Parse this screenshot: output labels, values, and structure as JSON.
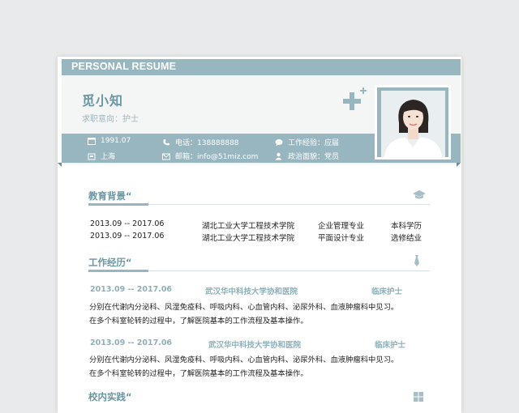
{
  "banner_title": "PERSONAL RESUME",
  "profile": {
    "name": "觅小知",
    "job_intention": "求职意向：护士"
  },
  "info": {
    "birth": "1991.07",
    "location": "上海",
    "phone": "电话：138888888",
    "email": "邮箱：info@51miz.com",
    "experience": "工作经验：应届",
    "politics": "政治面貌：党员"
  },
  "sections": {
    "education": {
      "title": "教育背景“",
      "rows": [
        {
          "period": "2013.09 -- 2017.06",
          "school": "湖北工业大学工程技术学院",
          "major": "企业管理专业",
          "degree": "本科学历"
        },
        {
          "period": "2013.09 -- 2017.06",
          "school": "湖北工业大学工程技术学院",
          "major": "平面设计专业",
          "degree": "选修结业"
        }
      ]
    },
    "work": {
      "title": "工作经历“",
      "entries": [
        {
          "period": "2013.09 -- 2017.06",
          "company": "武汉华中科技大学协和医院",
          "role": "临床护士",
          "lines": [
            "分别在代谢内分泌科、风湿免疫科、呼吸内科、心血管内科、泌尿外科、血液肿瘤科中见习。",
            "在多个科室轮转的过程中，了解医院基本的工作流程及基本操作。"
          ]
        },
        {
          "period": "2013.09 -- 2017.06",
          "company": "武汉华中科技大学协和医院",
          "role": "临床护士",
          "lines": [
            "分别在代谢内分泌科、风湿免疫科、呼吸内科、心血管内科、泌尿外科、血液肿瘤科中见习。",
            "在多个科室轮转的过程中，了解医院基本的工作流程及基本操作。"
          ]
        }
      ]
    },
    "campus": {
      "title": "校内实践“"
    }
  },
  "colors": {
    "accent": "#98b6c0",
    "title_text": "#6b96a3",
    "background": "#e8eaeb"
  },
  "icons": [
    "plus-icon",
    "calendar-icon",
    "location-icon",
    "phone-icon",
    "mail-icon",
    "chat-icon",
    "user-icon",
    "graduation-cap-icon",
    "tie-icon",
    "windows-icon"
  ]
}
